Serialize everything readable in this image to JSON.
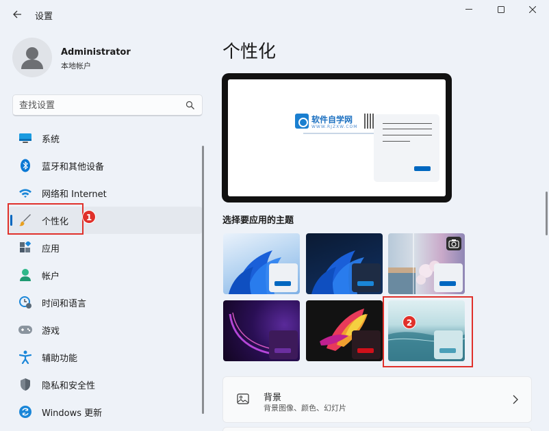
{
  "window": {
    "title": "设置",
    "controls": [
      "minimize-icon",
      "maximize-icon",
      "close-icon"
    ]
  },
  "user": {
    "name": "Administrator",
    "account_type": "本地帐户"
  },
  "search": {
    "placeholder": "查找设置"
  },
  "sidebar": {
    "items": [
      {
        "label": "系统",
        "icon": "monitor-icon"
      },
      {
        "label": "蓝牙和其他设备",
        "icon": "bluetooth-icon"
      },
      {
        "label": "网络和 Internet",
        "icon": "wifi-icon"
      },
      {
        "label": "个性化",
        "icon": "paintbrush-icon",
        "selected": true
      },
      {
        "label": "应用",
        "icon": "apps-icon"
      },
      {
        "label": "帐户",
        "icon": "person-icon"
      },
      {
        "label": "时间和语言",
        "icon": "clock-globe-icon"
      },
      {
        "label": "游戏",
        "icon": "gamepad-icon"
      },
      {
        "label": "辅助功能",
        "icon": "accessibility-icon"
      },
      {
        "label": "隐私和安全性",
        "icon": "shield-icon"
      },
      {
        "label": "Windows 更新",
        "icon": "update-icon"
      }
    ]
  },
  "annotations": {
    "badge1": "1",
    "badge2": "2",
    "color": "#e0302a"
  },
  "main": {
    "title": "个性化",
    "preview": {
      "watermark_text": "软件自学网",
      "watermark_url": "WWW.RJZXW.COM"
    },
    "themes_label": "选择要应用的主题",
    "themes": [
      {
        "name": "windows-light-bloom",
        "accent": "#0067c0"
      },
      {
        "name": "windows-dark-bloom",
        "accent": "#0067c0"
      },
      {
        "name": "windows-spotlight",
        "accent": "#0067c0"
      },
      {
        "name": "glow",
        "accent": "#6b2fa0"
      },
      {
        "name": "captured-motion",
        "accent": "#d0101a"
      },
      {
        "name": "flow",
        "accent": "#4a9fb8"
      }
    ],
    "background_card": {
      "title": "背景",
      "subtitle": "背景图像、颜色、幻灯片"
    }
  },
  "colors": {
    "accent": "#0067c0",
    "window_bg": "#eef2f8"
  }
}
